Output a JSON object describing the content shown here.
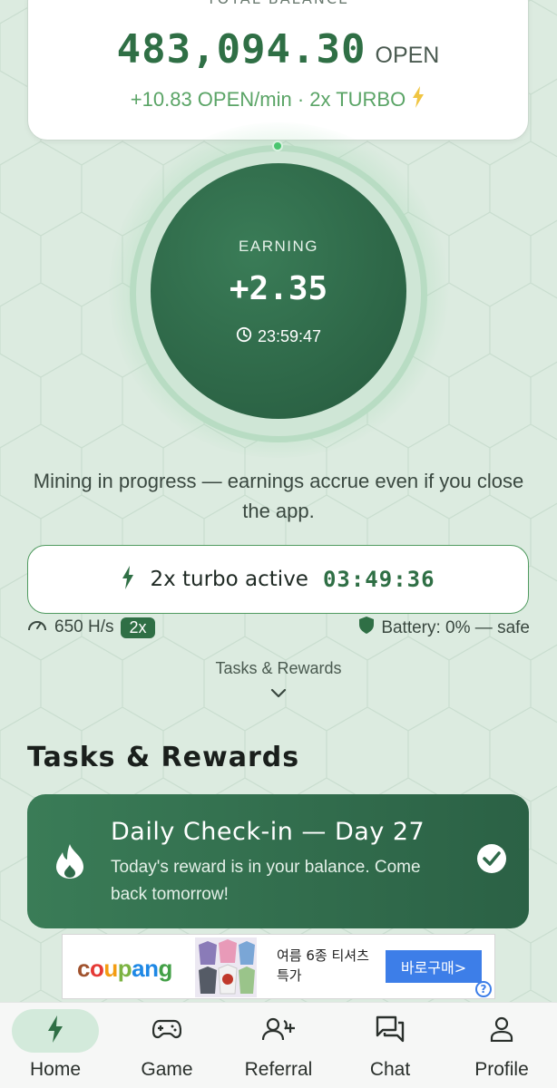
{
  "balance": {
    "top_label": "TOTAL BALANCE",
    "value": "483,094.30",
    "unit": "OPEN",
    "rate": "+10.83 OPEN/min · 2x TURBO"
  },
  "miner": {
    "label": "EARNING",
    "value": "+2.35",
    "timer": "23:59:47"
  },
  "mining_message": "Mining in progress — earnings accrue even if you close the app.",
  "turbo": {
    "label": "2x turbo active",
    "timer": "03:49:36"
  },
  "stats": {
    "hashrate": "650 H/s",
    "multiplier_badge": "2x",
    "battery": "Battery: 0% — safe"
  },
  "tasks_link": "Tasks & Rewards",
  "tasks_section": {
    "title": "Tasks & Rewards",
    "checkin": {
      "title": "Daily Check-in — Day 27",
      "description": "Today's reward is in your balance. Come back tomorrow!"
    }
  },
  "ad": {
    "brand": "coupang",
    "text": "여름 6종 티셔츠 특가",
    "button": "바로구매>",
    "info": "?"
  },
  "nav": {
    "items": [
      {
        "label": "Home",
        "icon": "bolt-icon",
        "active": true
      },
      {
        "label": "Game",
        "icon": "gamepad-icon",
        "active": false
      },
      {
        "label": "Referral",
        "icon": "add-user-icon",
        "active": false
      },
      {
        "label": "Chat",
        "icon": "chat-icon",
        "active": false
      },
      {
        "label": "Profile",
        "icon": "profile-icon",
        "active": false
      }
    ]
  },
  "colors": {
    "background": "#dcebe0",
    "accent_green": "#2f6f45",
    "card_green": "#3a7c57",
    "rate_green": "#5aa466",
    "turbo_yellow": "#f0c542",
    "ad_blue": "#3d7ee8"
  }
}
